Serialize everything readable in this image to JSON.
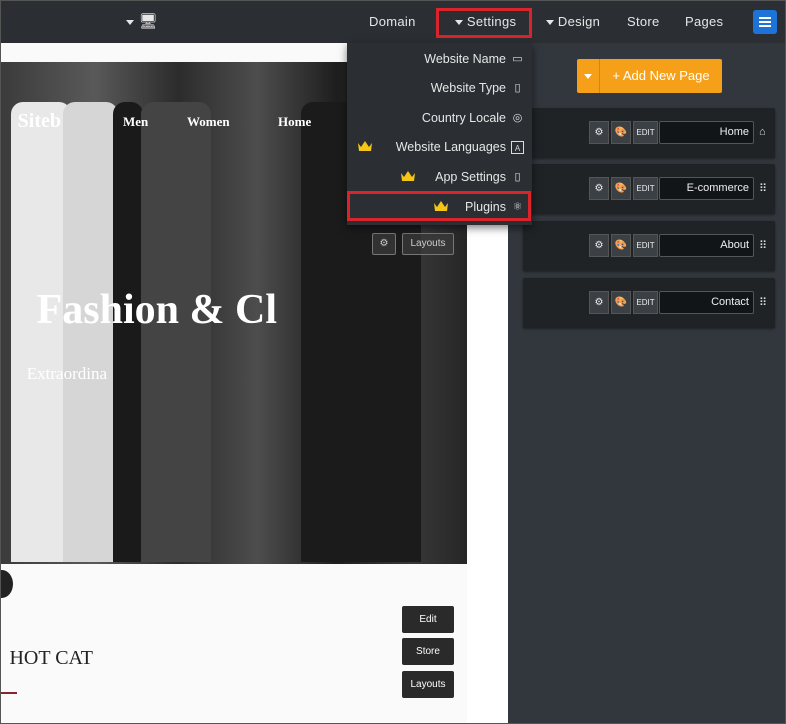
{
  "topbar": {
    "pages": "Pages",
    "store": "Store",
    "design": "Design",
    "settings": "Settings",
    "domain": "Domain"
  },
  "settings_menu": {
    "items": [
      {
        "label": "Website Name",
        "icon": "browser-window-icon",
        "premium": false
      },
      {
        "label": "Website Type",
        "icon": "document-icon",
        "premium": false
      },
      {
        "label": "Country Locale",
        "icon": "globe-icon",
        "premium": false
      },
      {
        "label": "Website Languages",
        "icon": "language-icon",
        "premium": true
      },
      {
        "label": "App Settings",
        "icon": "mobile-icon",
        "premium": true
      },
      {
        "label": "Plugins",
        "icon": "plugin-atom-icon",
        "premium": true
      }
    ],
    "highlighted": "Plugins",
    "crown_color": "#f5c518"
  },
  "preview": {
    "brand": "Siteb",
    "nav": [
      "Home",
      "Women",
      "Men"
    ],
    "hero_title": "Fashion & Cl",
    "hero_subtitle": "Extraordina",
    "hero_layouts": "Layouts",
    "section_title": "HOT CAT",
    "section_buttons": [
      "Edit",
      "Store",
      "Layouts"
    ]
  },
  "panel": {
    "add_button": "+ Add New Page",
    "edit_label": "EDIT",
    "pages": [
      {
        "name": "Home",
        "icon": "home-icon"
      },
      {
        "name": "E-commerce",
        "icon": "drag-handle-icon"
      },
      {
        "name": "About",
        "icon": "drag-handle-icon"
      },
      {
        "name": "Contact",
        "icon": "drag-handle-icon"
      }
    ]
  },
  "colors": {
    "topbar": "#2b2f33",
    "panel": "#31373d",
    "accent_orange": "#f6a01a",
    "highlight_red": "#d9242b",
    "logo_blue": "#1e73d8"
  }
}
